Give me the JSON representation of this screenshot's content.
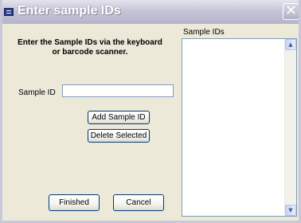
{
  "window": {
    "title": "Enter sample IDs",
    "close_glyph": "✕"
  },
  "instructions": {
    "line1": "Enter the Sample IDs via the keyboard",
    "line2": "or barcode scanner."
  },
  "sample_id": {
    "label": "Sample ID",
    "value": "",
    "placeholder": ""
  },
  "buttons": {
    "add": "Add Sample ID",
    "delete": "Delete Selected",
    "finished": "Finished",
    "cancel": "Cancel"
  },
  "list": {
    "label": "Sample IDs",
    "items": [],
    "scroll_up_glyph": "▲",
    "scroll_down_glyph": "▼"
  },
  "icons": {
    "window": "window-menu-icon",
    "close": "close-icon",
    "scroll_up": "scroll-up-arrow-icon",
    "scroll_down": "scroll-down-arrow-icon"
  },
  "colors": {
    "titlebar": "#c6c5d7",
    "dialog_background": "#ece9d8",
    "button_border": "#003c74",
    "input_border": "#7f9db9"
  }
}
